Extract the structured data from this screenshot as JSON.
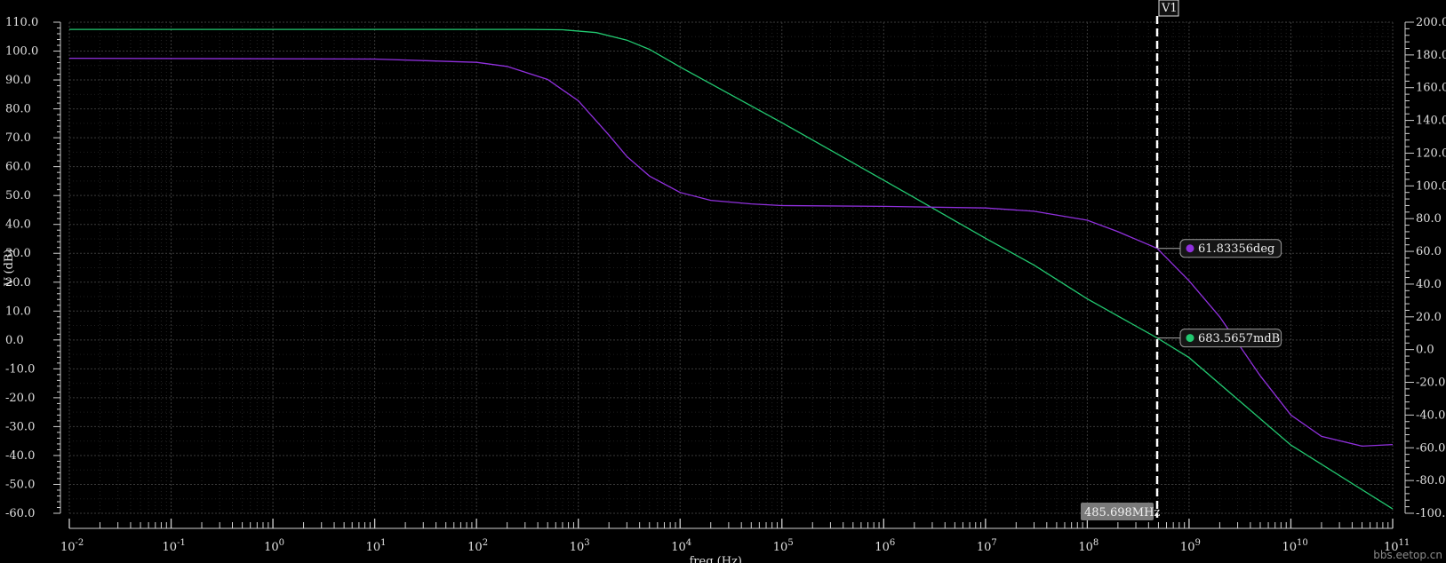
{
  "chart_data": {
    "type": "line",
    "xlabel": "freq (Hz)",
    "ylabel_left": "V (dB)",
    "x_scale": "log",
    "xlim": [
      0.01,
      100000000000
    ],
    "x_tick_exponents": [
      -2,
      -1,
      0,
      1,
      2,
      3,
      4,
      5,
      6,
      7,
      8,
      9,
      10,
      11
    ],
    "y_left_lim": [
      -60,
      110
    ],
    "y_left_ticks": [
      "110.0",
      "100.0",
      "90.0",
      "80.0",
      "70.0",
      "60.0",
      "50.0",
      "40.0",
      "30.0",
      "20.0",
      "10.0",
      "0.0",
      "-10.0",
      "-20.0",
      "-30.0",
      "-40.0",
      "-50.0",
      "-60.0"
    ],
    "y_right_lim": [
      -100,
      200
    ],
    "y_right_ticks": [
      "200.0",
      "180.0",
      "160.0",
      "140.0",
      "120.0",
      "100.0",
      "80.0",
      "60.0",
      "40.0",
      "20.0",
      "0.0",
      "-20.0",
      "-40.0",
      "-60.0",
      "-80.0",
      "-100.0"
    ],
    "grid": true,
    "series": [
      {
        "id": "gain",
        "axis": "left",
        "color": "#22c870",
        "x": [
          0.01,
          100,
          300,
          700,
          1500,
          3000,
          5000,
          10000,
          100000,
          1000000,
          10000000,
          30000000,
          100000000,
          485698000,
          1000000000,
          10000000000,
          100000000000
        ],
        "y": [
          107.5,
          107.5,
          107.5,
          107.4,
          106.4,
          103.8,
          100.6,
          94.5,
          75.2,
          55.3,
          35.2,
          25.9,
          14.2,
          0.684,
          -6.1,
          -36.4,
          -58.5
        ]
      },
      {
        "id": "phase",
        "axis": "right",
        "color": "#9030dd",
        "x": [
          0.01,
          10,
          100,
          200,
          500,
          1000,
          2000,
          3000,
          5000,
          10000,
          20000,
          50000,
          100000,
          1000000,
          10000000,
          30000000,
          100000000,
          200000000,
          485698000,
          1000000000,
          2000000000,
          5000000000,
          10000000000,
          20000000000,
          50000000000,
          100000000000
        ],
        "y": [
          178,
          177.5,
          175.5,
          173,
          165,
          152,
          131,
          118,
          106,
          96,
          91.2,
          89,
          88,
          87.5,
          86.5,
          84.5,
          79,
          72,
          61.8,
          42,
          20,
          -16,
          -40,
          -53,
          -59,
          -58
        ]
      }
    ]
  },
  "cursor": {
    "label": "V1",
    "freq_hz": 485698000,
    "freq_label": "485.698MHz"
  },
  "markers": [
    {
      "series": "phase",
      "label": "61.83356deg",
      "dot_color": "#9030dd"
    },
    {
      "series": "gain",
      "label": "683.5657mdB",
      "dot_color": "#22c870"
    }
  ],
  "watermark": "bbs.eetop.cn"
}
